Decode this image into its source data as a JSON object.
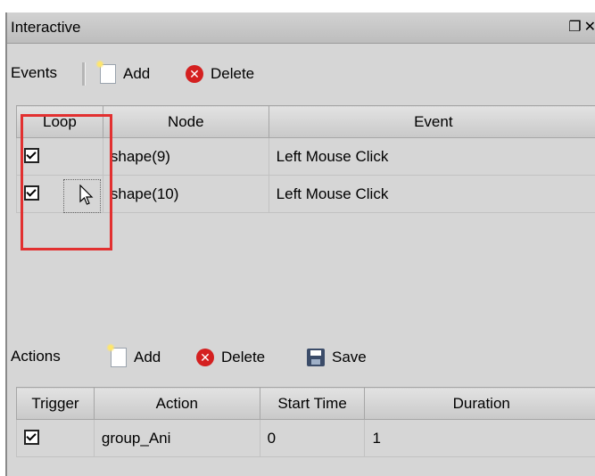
{
  "panel": {
    "title": "Interactive",
    "title_buttons": "❐✕"
  },
  "events_toolbar": {
    "label": "Events",
    "add_label": "Add",
    "delete_label": "Delete"
  },
  "events_table": {
    "columns": [
      "Loop",
      "Node",
      "Event"
    ],
    "rows": [
      {
        "loop": true,
        "node": "shape(9)",
        "event": "Left Mouse Click"
      },
      {
        "loop": true,
        "node": "shape(10)",
        "event": "Left Mouse Click"
      }
    ]
  },
  "actions_toolbar": {
    "label": "Actions",
    "add_label": "Add",
    "delete_label": "Delete",
    "save_label": "Save"
  },
  "actions_table": {
    "columns": [
      "Trigger",
      "Action",
      "Start Time",
      "Duration"
    ],
    "rows": [
      {
        "trigger": true,
        "action": "group_Ani",
        "start_time": "0",
        "duration": "1"
      }
    ]
  },
  "icons": {
    "add": "add-document-icon",
    "delete": "delete-red-x-icon",
    "save": "floppy-save-icon",
    "checkbox": "checkbox-checked-icon",
    "cursor": "mouse-pointer-icon"
  },
  "colors": {
    "highlight": "#e23030",
    "delete_icon": "#d42020",
    "panel_bg": "#d6d6d6"
  }
}
